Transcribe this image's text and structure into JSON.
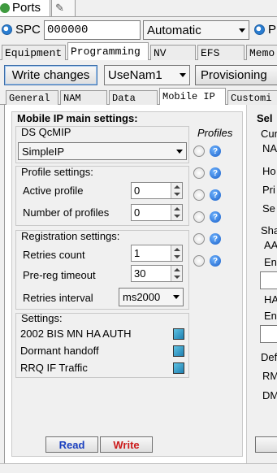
{
  "top_tabs": {
    "ports": "Ports"
  },
  "spc": {
    "label": "SPC",
    "value": "000000",
    "mode": "Automatic",
    "right_fragment": "P"
  },
  "main_tabs": [
    "Equipment",
    "Programming",
    "NV",
    "EFS",
    "Memo"
  ],
  "toolbar": {
    "write_changes": "Write changes",
    "nam_select": "UseNam1",
    "provisioning": "Provisioning"
  },
  "sub_tabs": [
    "General",
    "NAM",
    "Data",
    "Mobile IP",
    "Customi"
  ],
  "mip": {
    "title": "Mobile IP main settings:",
    "ds_label": "DS QcMIP",
    "ds_value": "SimpleIP",
    "profiles_label": "Profiles",
    "profile_settings_label": "Profile settings:",
    "active_profile_label": "Active profile",
    "active_profile_value": "0",
    "num_profiles_label": "Number of profiles",
    "num_profiles_value": "0",
    "registration_label": "Registration settings:",
    "retries_count_label": "Retries count",
    "retries_count_value": "1",
    "prereg_label": "Pre-reg timeout",
    "prereg_value": "30",
    "retries_interval_label": "Retries interval",
    "retries_interval_value": "ms2000",
    "settings_label": "Settings:",
    "settings": [
      {
        "label": "2002 BIS MN HA AUTH"
      },
      {
        "label": "Dormant handoff"
      },
      {
        "label": "RRQ IF Traffic"
      }
    ],
    "read_button": "Read",
    "write_button": "Write"
  },
  "right_panel": {
    "title": "Sel",
    "cur": "Cur",
    "na": "NA",
    "ho": "Ho",
    "pri": "Pri",
    "se": "Se",
    "sha": "Sha",
    "aa": "AA",
    "en1": "En",
    "ha": "HA",
    "en2": "En",
    "def": "Def",
    "rm": "RM",
    "dm": "DM"
  },
  "colors": {
    "read": "#1a3fbf",
    "write": "#cc1a1a",
    "checkbox": "#1f8fc4"
  }
}
